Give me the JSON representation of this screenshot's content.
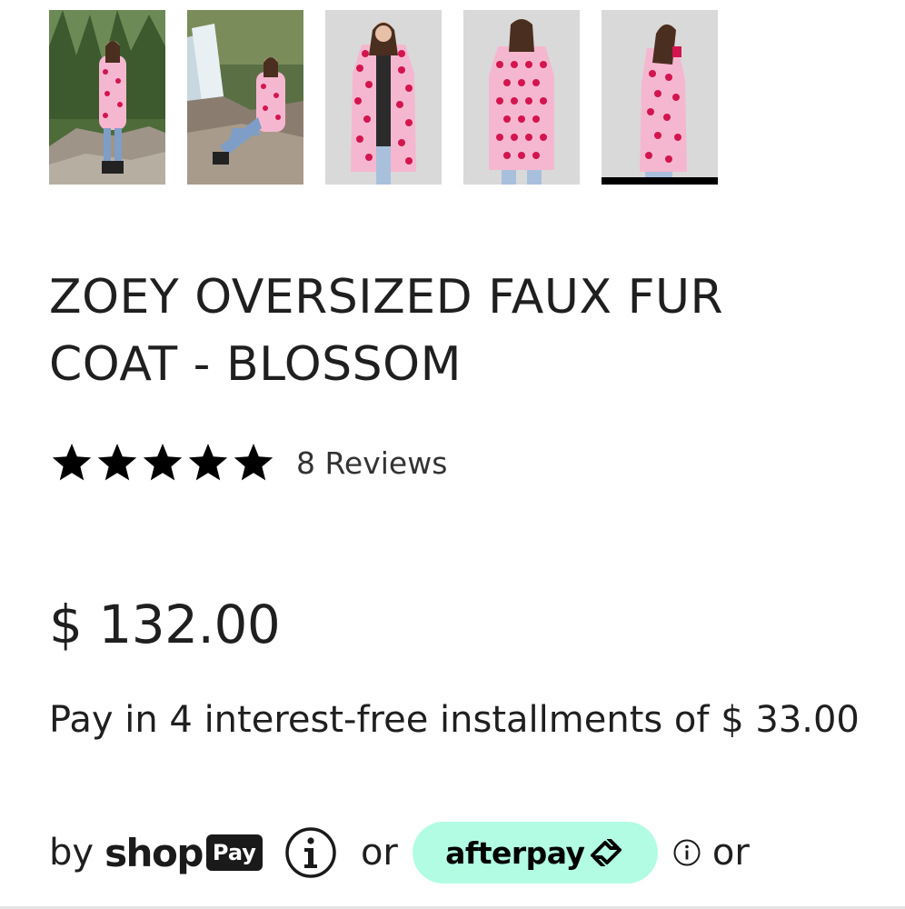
{
  "gallery": {
    "thumbnails": [
      {
        "icon": "model-on-rocks-photo",
        "active": false
      },
      {
        "icon": "model-by-waterfall-photo",
        "active": false
      },
      {
        "icon": "model-front-studio-photo",
        "active": false
      },
      {
        "icon": "model-back-studio-photo",
        "active": false
      },
      {
        "icon": "model-side-studio-photo",
        "active": true
      }
    ]
  },
  "product": {
    "title": "ZOEY OVERSIZED FAUX FUR COAT - BLOSSOM",
    "rating": 5,
    "rating_max": 5,
    "reviews_label": "8 Reviews",
    "price": "$ 132.00"
  },
  "installments": {
    "text": "Pay in 4 interest-free installments of $ 33.00",
    "by_label": "by",
    "shop_word": "shop",
    "pay_word": "Pay",
    "or_label_1": "or",
    "afterpay_word": "afterpay",
    "or_label_2": "or"
  },
  "colors": {
    "coat_pink": "#f5b7cf",
    "heart_red": "#d3154f",
    "afterpay_mint": "#b2fce4",
    "text": "#1f1f1f"
  }
}
